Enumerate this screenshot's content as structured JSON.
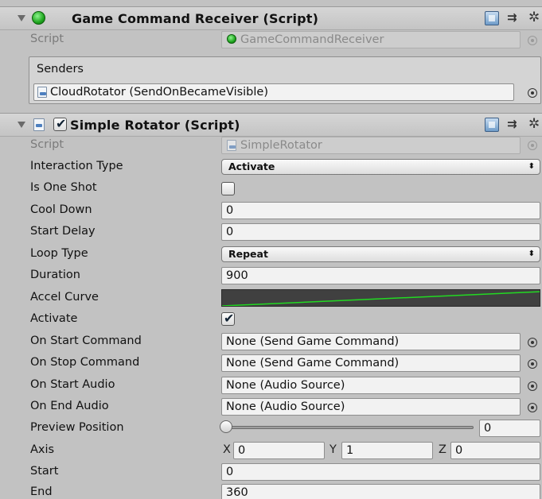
{
  "component1": {
    "title": "Game Command Receiver (Script)",
    "script_label": "Script",
    "script_value": "GameCommandReceiver",
    "senders_label": "Senders",
    "sender_value": "CloudRotator (SendOnBecameVisible)"
  },
  "component2": {
    "title": "Simple Rotator (Script)",
    "enabled": true,
    "checkmark": "✔",
    "script_label": "Script",
    "script_value": "SimpleRotator",
    "fields": {
      "interaction_type": {
        "label": "Interaction Type",
        "value": "Activate"
      },
      "is_one_shot": {
        "label": "Is One Shot",
        "checked": false
      },
      "cool_down": {
        "label": "Cool Down",
        "value": "0"
      },
      "start_delay": {
        "label": "Start Delay",
        "value": "0"
      },
      "loop_type": {
        "label": "Loop Type",
        "value": "Repeat"
      },
      "duration": {
        "label": "Duration",
        "value": "900"
      },
      "accel_curve": {
        "label": "Accel Curve",
        "curve_color": "#22d922"
      },
      "activate": {
        "label": "Activate",
        "checked": true,
        "checkmark": "✔"
      },
      "on_start_command": {
        "label": "On Start Command",
        "value": "None (Send Game Command)"
      },
      "on_stop_command": {
        "label": "On Stop Command",
        "value": "None (Send Game Command)"
      },
      "on_start_audio": {
        "label": "On Start Audio",
        "value": "None (Audio Source)"
      },
      "on_end_audio": {
        "label": "On End Audio",
        "value": "None (Audio Source)"
      },
      "preview_position": {
        "label": "Preview Position",
        "value": "0"
      },
      "axis": {
        "label": "Axis",
        "x_label": "X",
        "x": "0",
        "y_label": "Y",
        "y": "1",
        "z_label": "Z",
        "z": "0"
      },
      "start": {
        "label": "Start",
        "value": "0"
      },
      "end": {
        "label": "End",
        "value": "360"
      }
    }
  },
  "icons": {
    "header_help": "book-icon",
    "header_preset": "preset-icon",
    "header_gear": "gear-icon",
    "popup_arrow": "⬍",
    "preset_glyph": "⇉",
    "gear_glyph": "✲"
  },
  "colors": {
    "panel_bg": "#c2c2c2",
    "field_bg": "#f2f2f2",
    "curve_bg": "#404040",
    "curve_line": "#22d922"
  }
}
